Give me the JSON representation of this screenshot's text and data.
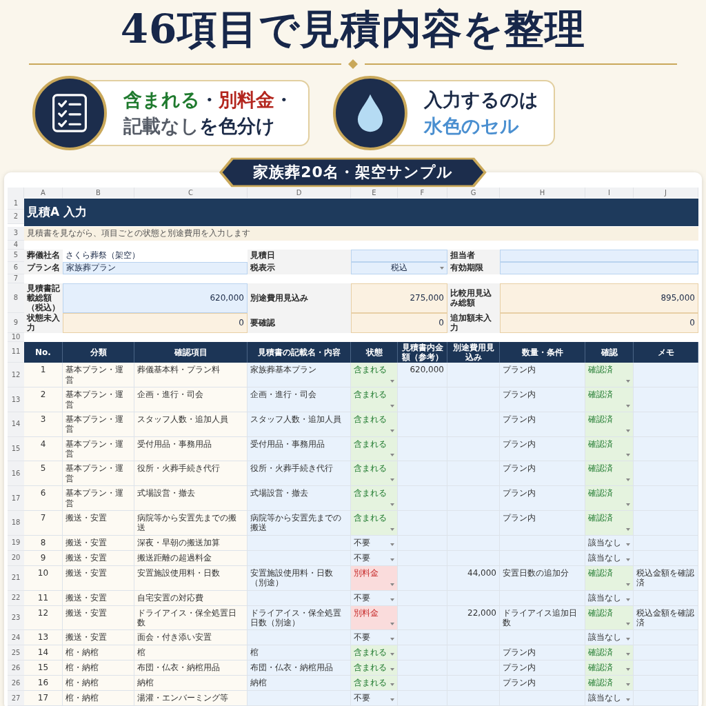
{
  "headline": "46項目で見積内容を整理",
  "features": [
    {
      "kind": "checklist",
      "lines": [
        [
          {
            "text": "含まれる",
            "color": "#1f7a2e"
          },
          {
            "text": "・",
            "color": "#1b2a47"
          },
          {
            "text": "別料金",
            "color": "#b3261e"
          },
          {
            "text": "・",
            "color": "#1b2a47"
          }
        ],
        [
          {
            "text": "記載なし",
            "color": "#555b66"
          },
          {
            "text": "を色分け",
            "color": "#1b2a47"
          }
        ]
      ]
    },
    {
      "kind": "drop",
      "lines": [
        [
          {
            "text": "入力するのは",
            "color": "#1b2a47"
          }
        ],
        [
          {
            "text": "水色のセル",
            "color": "#4a8fd0"
          }
        ]
      ]
    }
  ],
  "banner": "家族葬20名・架空サンプル",
  "sheet": {
    "column_letters": [
      "A",
      "B",
      "C",
      "D",
      "E",
      "F",
      "G",
      "H",
      "I",
      "J"
    ],
    "rows": [
      {
        "kind": "title",
        "numbers": [
          "1",
          "2"
        ],
        "text": "見積A 入力"
      },
      {
        "kind": "note",
        "number": "3",
        "text": "見積書を見ながら、項目ごとの状態と別途費用を入力します"
      },
      {
        "kind": "spacer",
        "number": "4"
      },
      {
        "kind": "info",
        "number": "5",
        "cells": [
          {
            "text": "葬儀社名",
            "kind": "label"
          },
          {
            "text": "さくら葬祭（架空）",
            "kind": "text"
          },
          {
            "text": "見積日",
            "kind": "label"
          },
          {
            "kind": "input"
          },
          {
            "text": "担当者",
            "kind": "label"
          },
          {
            "kind": "input"
          }
        ]
      },
      {
        "kind": "info",
        "number": "6",
        "cells": [
          {
            "text": "プラン名",
            "kind": "label"
          },
          {
            "text": "家族葬プラン",
            "kind": "input"
          },
          {
            "text": "税表示",
            "kind": "label"
          },
          {
            "text": "税込",
            "kind": "input",
            "dropdown": true
          },
          {
            "text": "有効期限",
            "kind": "label"
          },
          {
            "kind": "input"
          }
        ]
      },
      {
        "kind": "spacer",
        "number": "7"
      },
      {
        "kind": "summary",
        "number": "8",
        "cells": [
          {
            "text": "見積書記載総額（税込）",
            "kind": "label"
          },
          {
            "text": "620,000",
            "kind": "input"
          },
          {
            "text": "別途費用見込み",
            "kind": "label"
          },
          {
            "text": "275,000",
            "kind": "calc"
          },
          {
            "text": "比較用見込み総額",
            "kind": "label"
          },
          {
            "text": "895,000",
            "kind": "calc"
          }
        ]
      },
      {
        "kind": "summary",
        "number": "9",
        "cells": [
          {
            "text": "状態未入力",
            "kind": "label"
          },
          {
            "text": "0",
            "kind": "calc"
          },
          {
            "text": "要確認",
            "kind": "label"
          },
          {
            "text": "0",
            "kind": "calc"
          },
          {
            "text": "追加額未入力",
            "kind": "label"
          },
          {
            "text": "0",
            "kind": "calc"
          }
        ]
      },
      {
        "kind": "spacer",
        "number": "10"
      },
      {
        "kind": "header",
        "number": "11",
        "columns": [
          "No.",
          "分類",
          "確認項目",
          "見積書の記載名・内容",
          "状態",
          "見積書内金額（参考）",
          "別途費用見込み",
          "数量・条件",
          "確認",
          "メモ"
        ]
      }
    ],
    "entries": [
      {
        "number": "12",
        "no": "1",
        "category": "基本プラン・運営",
        "item": "葬儀基本料・プラン料",
        "listed": "家族葬基本プラン",
        "status": {
          "text": "含まれる",
          "kind": "included"
        },
        "amount": "620,000",
        "condition": "プラン内",
        "check": {
          "text": "確認済",
          "kind": "confirmed"
        }
      },
      {
        "number": "13",
        "no": "2",
        "category": "基本プラン・運営",
        "item": "企画・進行・司会",
        "listed": "企画・進行・司会",
        "status": {
          "text": "含まれる",
          "kind": "included"
        },
        "condition": "プラン内",
        "check": {
          "text": "確認済",
          "kind": "confirmed"
        }
      },
      {
        "number": "14",
        "no": "3",
        "category": "基本プラン・運営",
        "item": "スタッフ人数・追加人員",
        "listed": "スタッフ人数・追加人員",
        "status": {
          "text": "含まれる",
          "kind": "included"
        },
        "condition": "プラン内",
        "check": {
          "text": "確認済",
          "kind": "confirmed"
        }
      },
      {
        "number": "15",
        "no": "4",
        "category": "基本プラン・運営",
        "item": "受付用品・事務用品",
        "listed": "受付用品・事務用品",
        "status": {
          "text": "含まれる",
          "kind": "included"
        },
        "condition": "プラン内",
        "check": {
          "text": "確認済",
          "kind": "confirmed"
        }
      },
      {
        "number": "16",
        "no": "5",
        "category": "基本プラン・運営",
        "item": "役所・火葬手続き代行",
        "listed": "役所・火葬手続き代行",
        "status": {
          "text": "含まれる",
          "kind": "included"
        },
        "condition": "プラン内",
        "check": {
          "text": "確認済",
          "kind": "confirmed"
        }
      },
      {
        "number": "17",
        "no": "6",
        "category": "基本プラン・運営",
        "item": "式場設営・撤去",
        "listed": "式場設営・撤去",
        "status": {
          "text": "含まれる",
          "kind": "included"
        },
        "condition": "プラン内",
        "check": {
          "text": "確認済",
          "kind": "confirmed"
        }
      },
      {
        "number": "18",
        "no": "7",
        "category": "搬送・安置",
        "item": "病院等から安置先までの搬送",
        "listed": "病院等から安置先までの搬送",
        "status": {
          "text": "含まれる",
          "kind": "included"
        },
        "condition": "プラン内",
        "check": {
          "text": "確認済",
          "kind": "confirmed"
        }
      },
      {
        "number": "19",
        "no": "8",
        "category": "搬送・安置",
        "item": "深夜・早朝の搬送加算",
        "status": {
          "text": "不要",
          "kind": "none"
        },
        "check": {
          "text": "該当なし",
          "kind": "na"
        }
      },
      {
        "number": "20",
        "no": "9",
        "category": "搬送・安置",
        "item": "搬送距離の超過料金",
        "status": {
          "text": "不要",
          "kind": "none"
        },
        "check": {
          "text": "該当なし",
          "kind": "na"
        }
      },
      {
        "number": "21",
        "no": "10",
        "category": "搬送・安置",
        "item": "安置施設使用料・日数",
        "listed": "安置施設使用料・日数（別途）",
        "status": {
          "text": "別料金",
          "kind": "extra"
        },
        "extra": "44,000",
        "condition": "安置日数の追加分",
        "check": {
          "text": "確認済",
          "kind": "confirmed"
        },
        "memo": "税込金額を確認済"
      },
      {
        "number": "22",
        "no": "11",
        "category": "搬送・安置",
        "item": "自宅安置の対応費",
        "status": {
          "text": "不要",
          "kind": "none"
        },
        "check": {
          "text": "該当なし",
          "kind": "na"
        }
      },
      {
        "number": "23",
        "no": "12",
        "category": "搬送・安置",
        "item": "ドライアイス・保全処置日数",
        "listed": "ドライアイス・保全処置日数（別途）",
        "status": {
          "text": "別料金",
          "kind": "extra"
        },
        "extra": "22,000",
        "condition": "ドライアイス追加日数",
        "check": {
          "text": "確認済",
          "kind": "confirmed"
        },
        "memo": "税込金額を確認済"
      },
      {
        "number": "24",
        "no": "13",
        "category": "搬送・安置",
        "item": "面会・付き添い安置",
        "status": {
          "text": "不要",
          "kind": "none"
        },
        "check": {
          "text": "該当なし",
          "kind": "na"
        }
      },
      {
        "number": "25",
        "no": "14",
        "category": "棺・納棺",
        "item": "棺",
        "listed": "棺",
        "status": {
          "text": "含まれる",
          "kind": "included"
        },
        "condition": "プラン内",
        "check": {
          "text": "確認済",
          "kind": "confirmed"
        }
      },
      {
        "number": "26",
        "no": "15",
        "category": "棺・納棺",
        "item": "布団・仏衣・納棺用品",
        "listed": "布団・仏衣・納棺用品",
        "status": {
          "text": "含まれる",
          "kind": "included"
        },
        "condition": "プラン内",
        "check": {
          "text": "確認済",
          "kind": "confirmed"
        }
      },
      {
        "number": "26",
        "no": "16",
        "category": "棺・納棺",
        "item": "納棺",
        "listed": "納棺",
        "status": {
          "text": "含まれる",
          "kind": "included"
        },
        "condition": "プラン内",
        "check": {
          "text": "確認済",
          "kind": "confirmed"
        }
      },
      {
        "number": "27",
        "no": "17",
        "category": "棺・納棺",
        "item": "湯灌・エンバーミング等",
        "status": {
          "text": "不要",
          "kind": "none"
        },
        "check": {
          "text": "該当なし",
          "kind": "na"
        }
      }
    ]
  }
}
